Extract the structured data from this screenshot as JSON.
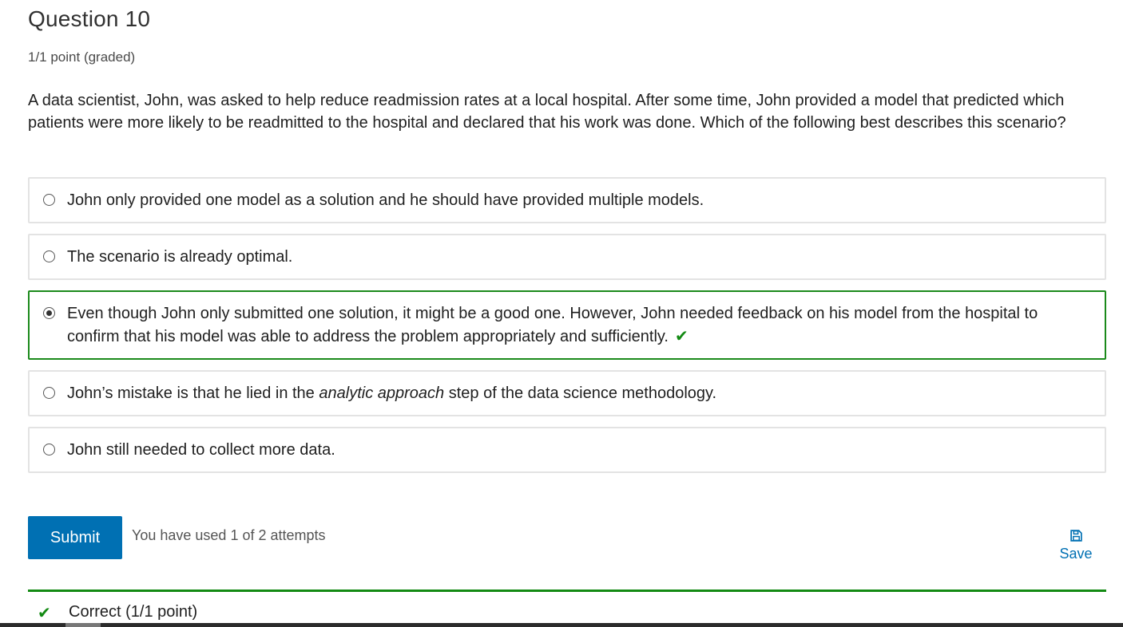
{
  "question": {
    "title": "Question 10",
    "points": "1/1 point (graded)",
    "prompt": "A data scientist, John, was asked to help reduce readmission rates at a local hospital. After some time, John provided a model that predicted which patients were more likely to be readmitted to the hospital and declared that his work was done. Which of the following best describes this scenario?"
  },
  "choices": [
    {
      "text": "John only provided one model as a solution and he should have provided multiple models.",
      "selected": false
    },
    {
      "text": "The scenario is already optimal.",
      "selected": false
    },
    {
      "text": "Even though John only submitted one solution, it might be a good one. However, John needed feedback on his model from the hospital to confirm that his model was able to address the problem appropriately and sufficiently.",
      "selected": true,
      "mark": "✔"
    },
    {
      "text_before": "John’s mistake is that he lied in the ",
      "text_emphasis": "analytic approach",
      "text_after": " step of the data science methodology.",
      "selected": false
    },
    {
      "text": "John still needed to collect more data.",
      "selected": false
    }
  ],
  "actions": {
    "submit_label": "Submit",
    "attempts_text": "You have used 1 of 2 attempts",
    "save_label": "Save"
  },
  "notification": {
    "mark": "✔",
    "text": "Correct (1/1 point)"
  },
  "icons": {
    "save": "floppy-disk-icon",
    "correct": "checkmark-icon"
  },
  "colors": {
    "accent": "#0070b3",
    "correct": "#138a13"
  }
}
